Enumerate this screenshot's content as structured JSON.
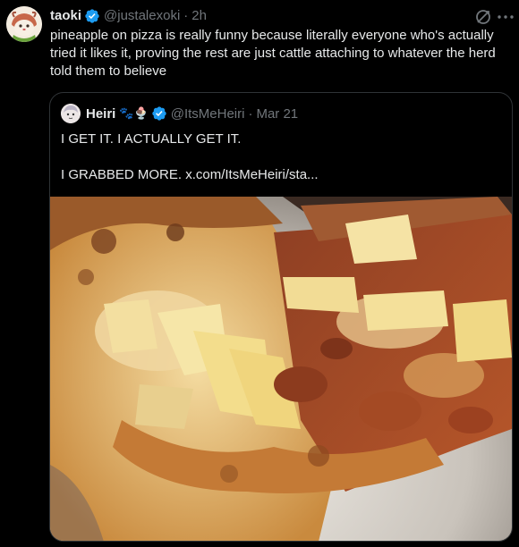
{
  "tweet": {
    "author_name": "taoki",
    "handle": "@justalexoki",
    "separator": "·",
    "time": "2h",
    "text": "pineapple on pizza is really funny because literally everyone who's actually tried it likes it, proving the rest are just cattle attaching to whatever the herd told them to believe"
  },
  "quote": {
    "author_name": "Heiri",
    "emojis": "🐾🍨",
    "handle": "@ItsMeHeiri",
    "separator": "·",
    "time": "Mar 21",
    "line1": "I GET IT. I ACTUALLY GET IT.",
    "line2": "I GRABBED MORE.  x.com/ItsMeHeiri/sta..."
  },
  "colors": {
    "background": "#000000",
    "text": "#e7e9ea",
    "muted": "#71767b",
    "verified": "#1d9bf0",
    "border": "#2f3336"
  },
  "icons": [
    "verified-badge-icon",
    "grok-icon",
    "more-icon"
  ]
}
